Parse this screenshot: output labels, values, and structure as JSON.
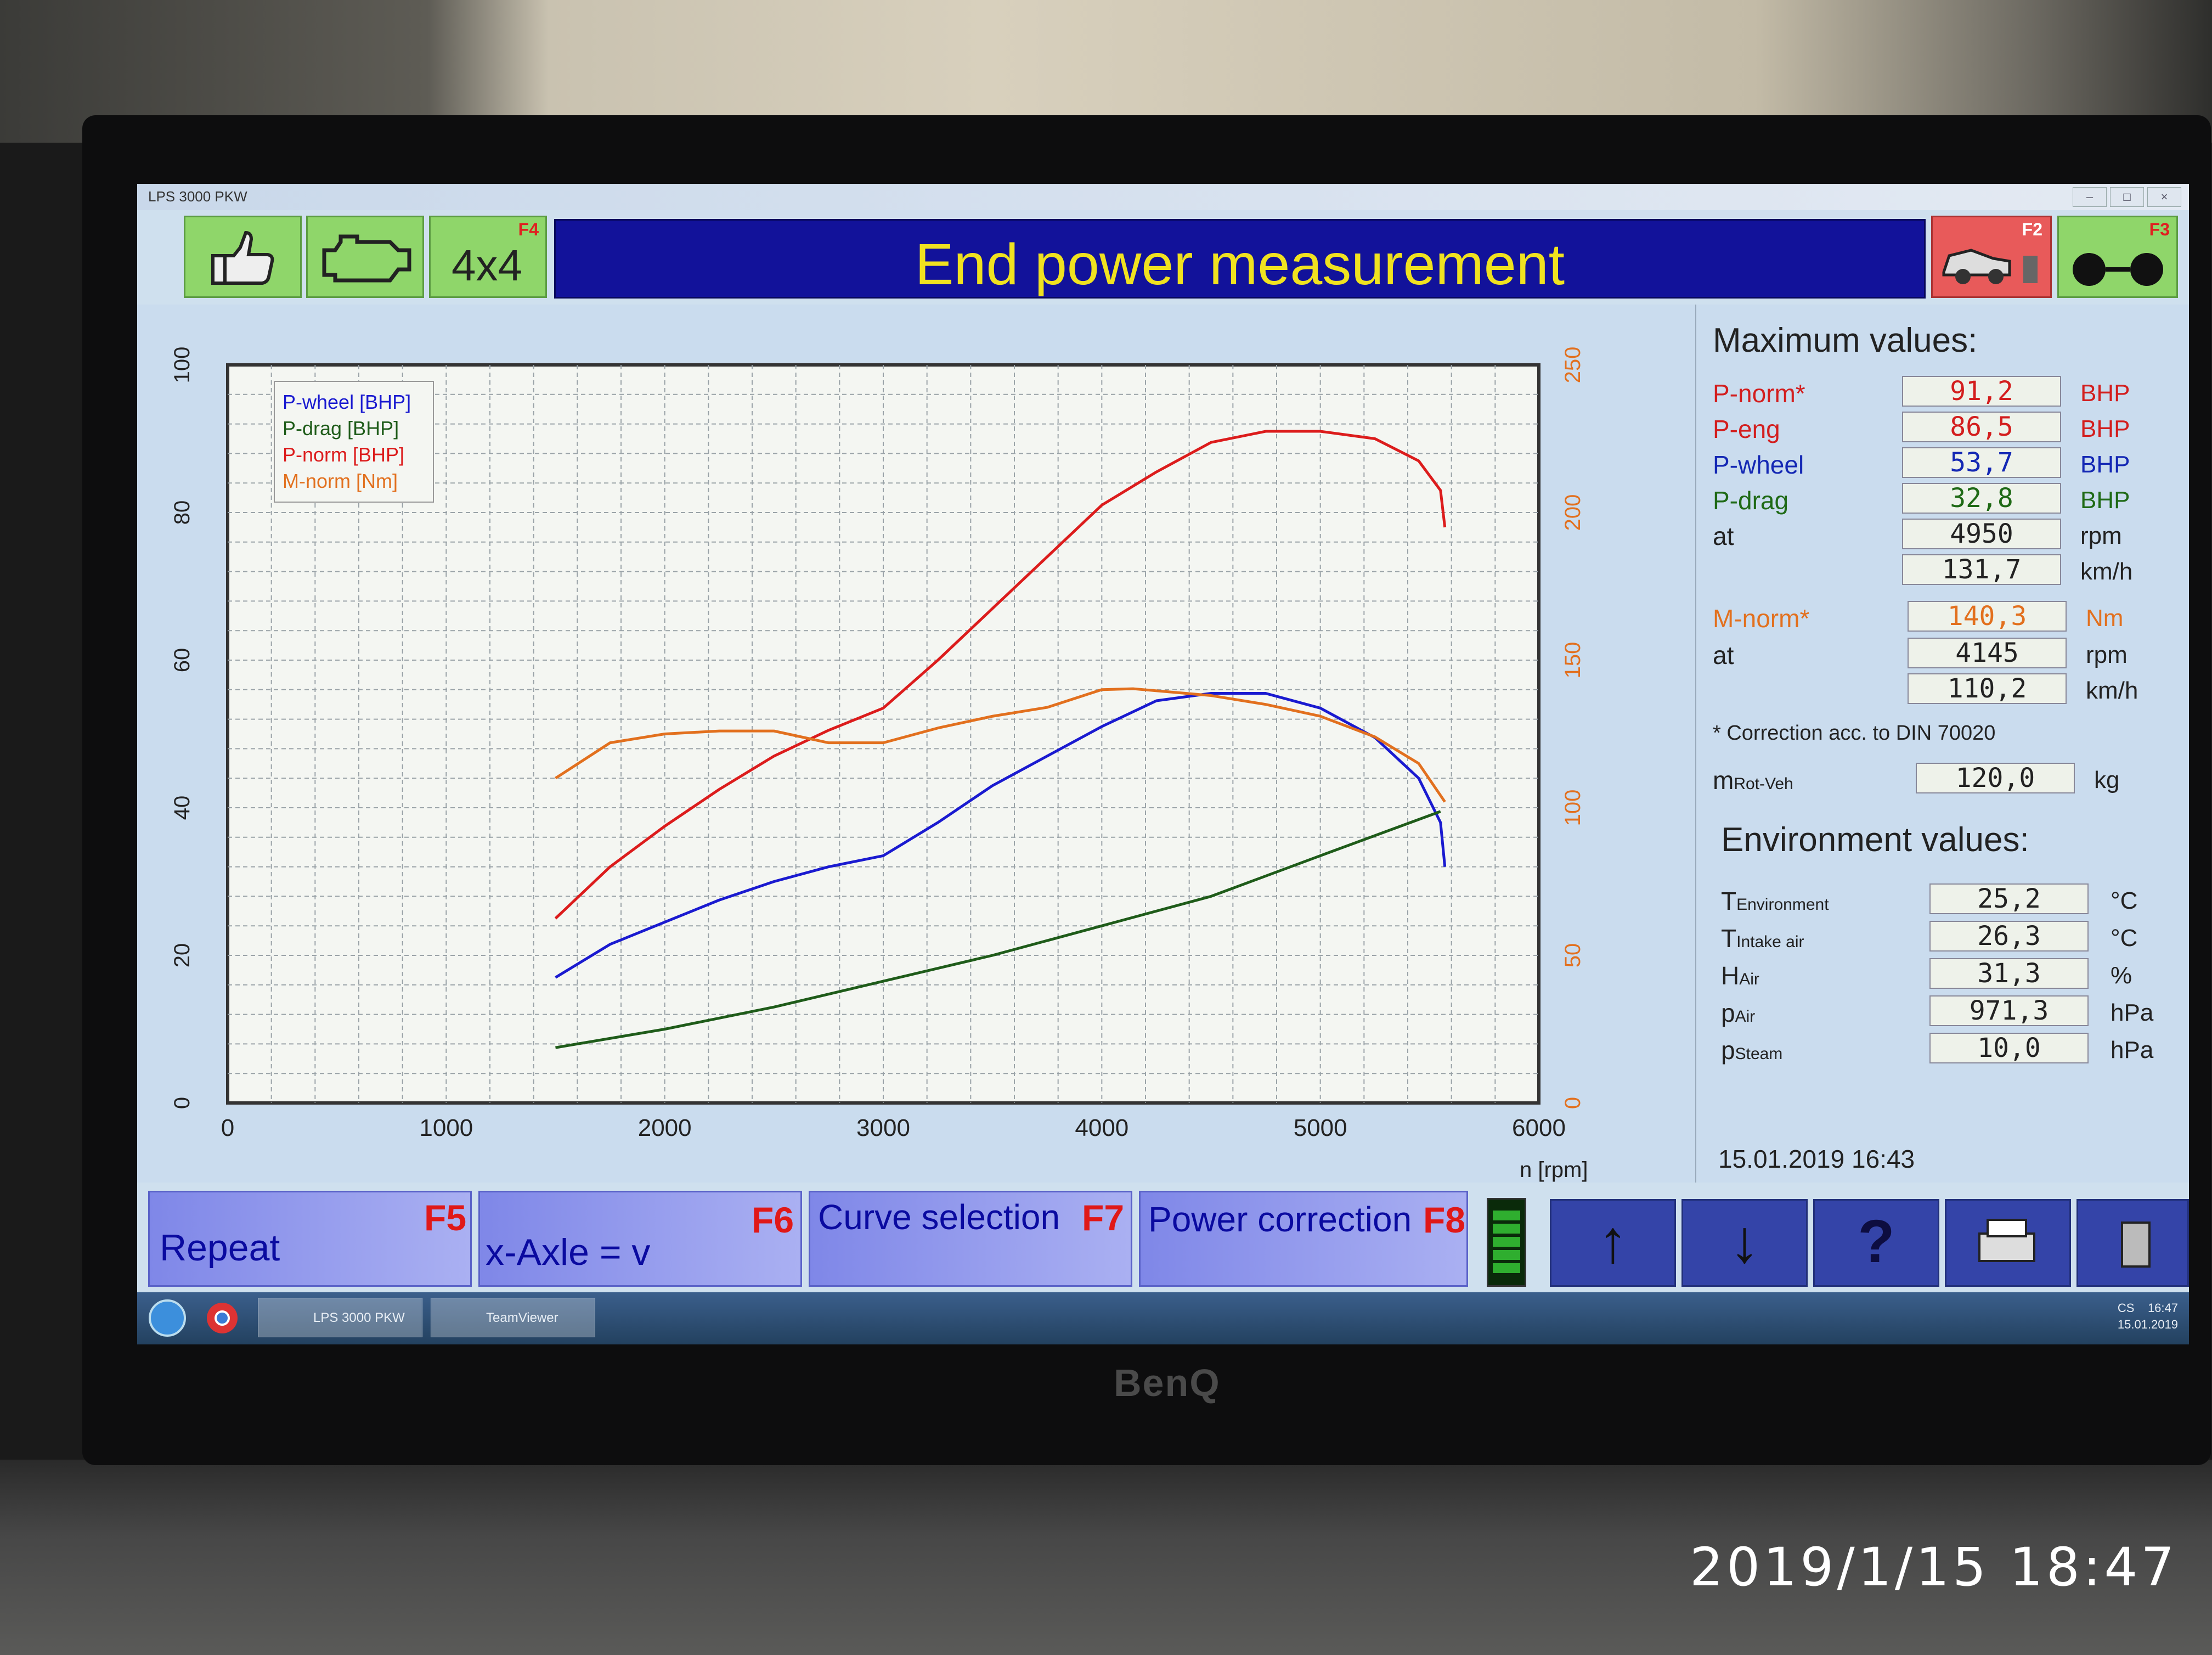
{
  "app": {
    "window_title": "LPS 3000 PKW",
    "title": "End power measurement"
  },
  "toolbar": {
    "btn_4x4_label": "4x4",
    "f4": "F4",
    "f2": "F2",
    "f3": "F3"
  },
  "chart_data": {
    "type": "line",
    "title": "",
    "xlabel": "n [rpm]",
    "xlim": [
      0,
      6000
    ],
    "ylim_left": [
      0,
      100
    ],
    "ylim_right": [
      0,
      250
    ],
    "x_ticks": [
      "0",
      "1000",
      "2000",
      "3000",
      "4000",
      "5000",
      "6000"
    ],
    "y_ticks_left": [
      "0",
      "20",
      "40",
      "60",
      "80",
      "100"
    ],
    "y_ticks_right": [
      "0",
      "50",
      "100",
      "150",
      "200",
      "250"
    ],
    "grid": true,
    "legend_position": "top-left",
    "series": [
      {
        "name": "P-wheel [BHP]",
        "color": "#1a1ad0",
        "axis": "left",
        "x": [
          1500,
          1750,
          2000,
          2250,
          2500,
          2750,
          3000,
          3250,
          3500,
          3750,
          4000,
          4250,
          4500,
          4750,
          5000,
          5250,
          5450,
          5550,
          5570
        ],
        "y": [
          17,
          21.5,
          24.5,
          27.5,
          30,
          32,
          33.5,
          38,
          43,
          47,
          51,
          54.5,
          55.5,
          55.5,
          53.5,
          49.5,
          44,
          38,
          32
        ]
      },
      {
        "name": "P-drag [BHP]",
        "color": "#1f5c1a",
        "axis": "left",
        "x": [
          1500,
          2000,
          2500,
          3000,
          3500,
          4000,
          4500,
          5000,
          5550
        ],
        "y": [
          7.5,
          10,
          13,
          16.5,
          20,
          24,
          28,
          33.5,
          39.5
        ]
      },
      {
        "name": "P-norm [BHP]",
        "color": "#dc1c1c",
        "axis": "left",
        "x": [
          1500,
          1750,
          2000,
          2250,
          2500,
          2750,
          3000,
          3250,
          3500,
          3750,
          4000,
          4250,
          4500,
          4750,
          5000,
          5250,
          5450,
          5550,
          5570
        ],
        "y": [
          25,
          32,
          37.5,
          42.5,
          47,
          50.5,
          53.5,
          60,
          67,
          74,
          81,
          85.5,
          89.5,
          91,
          91,
          90,
          87,
          83,
          78
        ]
      },
      {
        "name": "M-norm [Nm]",
        "color": "#e2701e",
        "axis": "right",
        "x": [
          1500,
          1750,
          2000,
          2250,
          2500,
          2750,
          3000,
          3250,
          3500,
          3750,
          4000,
          4145,
          4500,
          4750,
          5000,
          5250,
          5450,
          5570
        ],
        "y": [
          110,
          122,
          125,
          126,
          126,
          122,
          122,
          127,
          131,
          134,
          140,
          140.3,
          138,
          135,
          131,
          124,
          115,
          102
        ]
      }
    ]
  },
  "max_values": {
    "heading": "Maximum values:",
    "p_norm": {
      "label": "P-norm*",
      "value": "91,2",
      "unit": "BHP"
    },
    "p_eng": {
      "label": "P-eng",
      "value": "86,5",
      "unit": "BHP"
    },
    "p_wheel": {
      "label": "P-wheel",
      "value": "53,7",
      "unit": "BHP"
    },
    "p_drag": {
      "label": "P-drag",
      "value": "32,8",
      "unit": "BHP"
    },
    "at_label": "at",
    "rpm_value": "4950",
    "rpm_unit": "rpm",
    "speed_value": "131,7",
    "speed_unit": "km/h",
    "m_norm": {
      "label": "M-norm*",
      "value": "140,3",
      "unit": "Nm"
    },
    "m_at_label": "at",
    "m_rpm_value": "4145",
    "m_rpm_unit": "rpm",
    "m_speed_value": "110,2",
    "m_speed_unit": "km/h",
    "correction_note": "* Correction acc. to DIN 70020",
    "mrot_label": "m",
    "mrot_sub": "Rot-Veh",
    "mrot_value": "120,0",
    "mrot_unit": "kg"
  },
  "environment": {
    "heading": "Environment values:",
    "rows": [
      {
        "label": "T",
        "sub": "Environment",
        "value": "25,2",
        "unit": "°C"
      },
      {
        "label": "T",
        "sub": "Intake air",
        "value": "26,3",
        "unit": "°C"
      },
      {
        "label": "H",
        "sub": "Air",
        "value": "31,3",
        "unit": "%"
      },
      {
        "label": "p",
        "sub": "Air",
        "value": "971,3",
        "unit": "hPa"
      },
      {
        "label": "p",
        "sub": "Steam",
        "value": "10,0",
        "unit": "hPa"
      }
    ],
    "datetime": "15.01.2019  16:43"
  },
  "function_bar": {
    "f5_label": "Repeat",
    "f5": "F5",
    "f6_label": "x-Axle = v",
    "f6": "F6",
    "f7_label": "Curve selection",
    "f7": "F7",
    "f8_label": "Power correction",
    "f8": "F8",
    "up_arrow": "↑",
    "down_arrow": "↓",
    "help": "?"
  },
  "taskbar": {
    "task1": "LPS 3000 PKW",
    "task2": "TeamViewer",
    "lang": "CS",
    "time": "16:47",
    "date": "15.01.2019"
  },
  "monitor": {
    "brand": "BenQ",
    "photo_timestamp": "2019/1/15  18:47"
  }
}
